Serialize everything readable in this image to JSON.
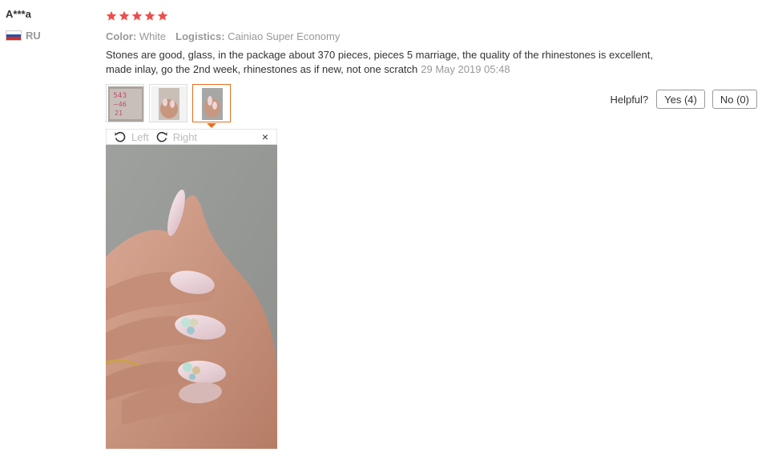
{
  "user": {
    "name": "A***a",
    "country": "RU"
  },
  "review": {
    "stars": 5,
    "star_color": "#ef4d4d",
    "color_label": "Color:",
    "color_value": "White",
    "logistics_label": "Logistics:",
    "logistics_value": "Cainiao Super Economy",
    "text_line1": "Stones are good, glass, in the package about 370 pieces, pieces 5 marriage, the quality of the rhinestones is excellent,",
    "text_line2": "made inlay, go the 2nd week, rhinestones as if new, not one scratch",
    "date": "29 May 2019 05:48"
  },
  "thumbnails": [
    {
      "name": "rhinestone-packets"
    },
    {
      "name": "nails-on-hand"
    },
    {
      "name": "nails-close-up",
      "active": true
    }
  ],
  "helpful": {
    "label": "Helpful?",
    "yes": "Yes (4)",
    "no": "No (0)"
  },
  "viewer": {
    "left": "Left",
    "right": "Right",
    "close": "×"
  },
  "accent": "#e96e1e"
}
